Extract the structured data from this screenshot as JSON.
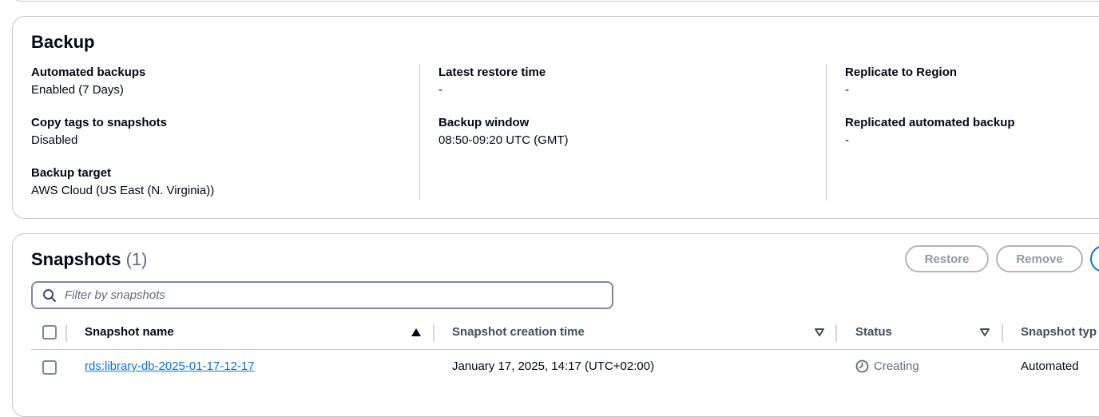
{
  "backup": {
    "title": "Backup",
    "col1": [
      {
        "label": "Automated backups",
        "value": "Enabled (7 Days)"
      },
      {
        "label": "Copy tags to snapshots",
        "value": "Disabled"
      },
      {
        "label": "Backup target",
        "value": "AWS Cloud (US East (N. Virginia))"
      }
    ],
    "col2": [
      {
        "label": "Latest restore time",
        "value": "-"
      },
      {
        "label": "Backup window",
        "value": "08:50-09:20 UTC (GMT)"
      }
    ],
    "col3": [
      {
        "label": "Replicate to Region",
        "value": "-"
      },
      {
        "label": "Replicated automated backup",
        "value": "-"
      }
    ]
  },
  "snapshots": {
    "title": "Snapshots",
    "count": "(1)",
    "buttons": {
      "restore": "Restore",
      "remove": "Remove"
    },
    "search_placeholder": "Filter by snapshots",
    "columns": [
      "Snapshot name",
      "Snapshot creation time",
      "Status",
      "Snapshot typ"
    ],
    "rows": [
      {
        "name": "rds:library-db-2025-01-17-12-17",
        "creation_time": "January 17, 2025, 14:17 (UTC+02:00)",
        "status": "Creating",
        "type": "Automated"
      }
    ]
  },
  "colors": {
    "link": "#0972d3",
    "border": "#c6c6cd",
    "muted_text": "#5f6b7a",
    "disabled_button": "#8d99a8"
  },
  "icons": {
    "search": "search-icon",
    "sort_asc": "sort-ascending-icon",
    "sort_desc": "sort-descending-icon",
    "status": "clock-icon"
  }
}
